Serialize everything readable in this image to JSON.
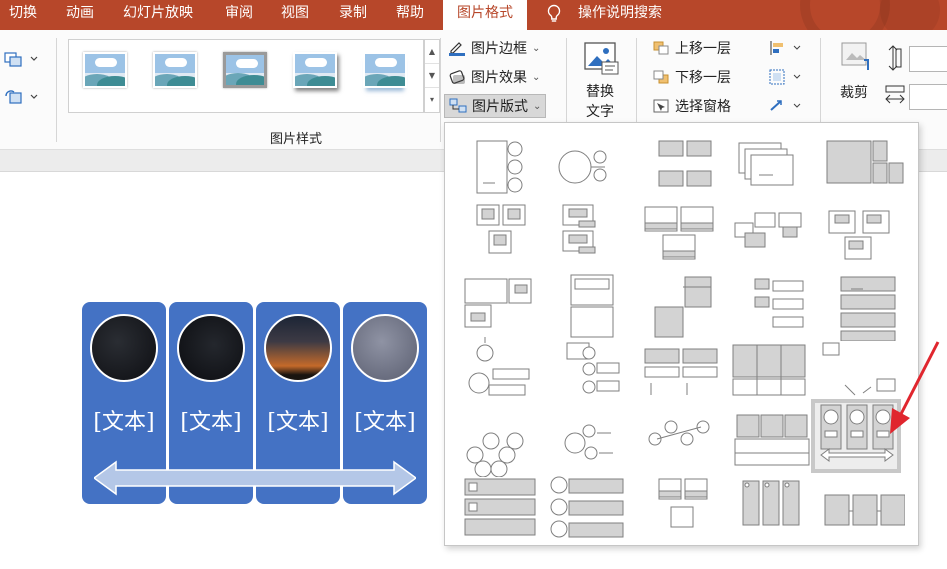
{
  "tabs": [
    {
      "label": "切换"
    },
    {
      "label": "动画"
    },
    {
      "label": "幻灯片放映"
    },
    {
      "label": "审阅"
    },
    {
      "label": "视图"
    },
    {
      "label": "录制"
    },
    {
      "label": "帮助"
    },
    {
      "label": "图片格式",
      "active": true
    }
  ],
  "search": {
    "label": "操作说明搜索"
  },
  "ribbon": {
    "picture_styles_group": "图片样式",
    "border_label": "图片边框",
    "effects_label": "图片效果",
    "layout_label": "图片版式",
    "alt_text_line1": "替换",
    "alt_text_line2": "文字",
    "bring_forward": "上移一层",
    "send_backward": "下移一层",
    "selection_pane": "选择窗格",
    "crop": "裁剪"
  },
  "slide": {
    "smartart_texts": [
      "[文本]",
      "[文本]",
      "[文本]",
      "[文本]"
    ]
  },
  "layout_gallery": {
    "rows": 6,
    "cols": 5,
    "selected_row": 4,
    "selected_col": 4
  },
  "colors": {
    "accent": "#b7472a",
    "smartart_fill": "#4472c4",
    "arrow_fill": "#b4c7e7",
    "callout_red": "#e0262e",
    "layout_gray": "#d3d3d3",
    "layout_stroke": "#7f7f7f"
  }
}
